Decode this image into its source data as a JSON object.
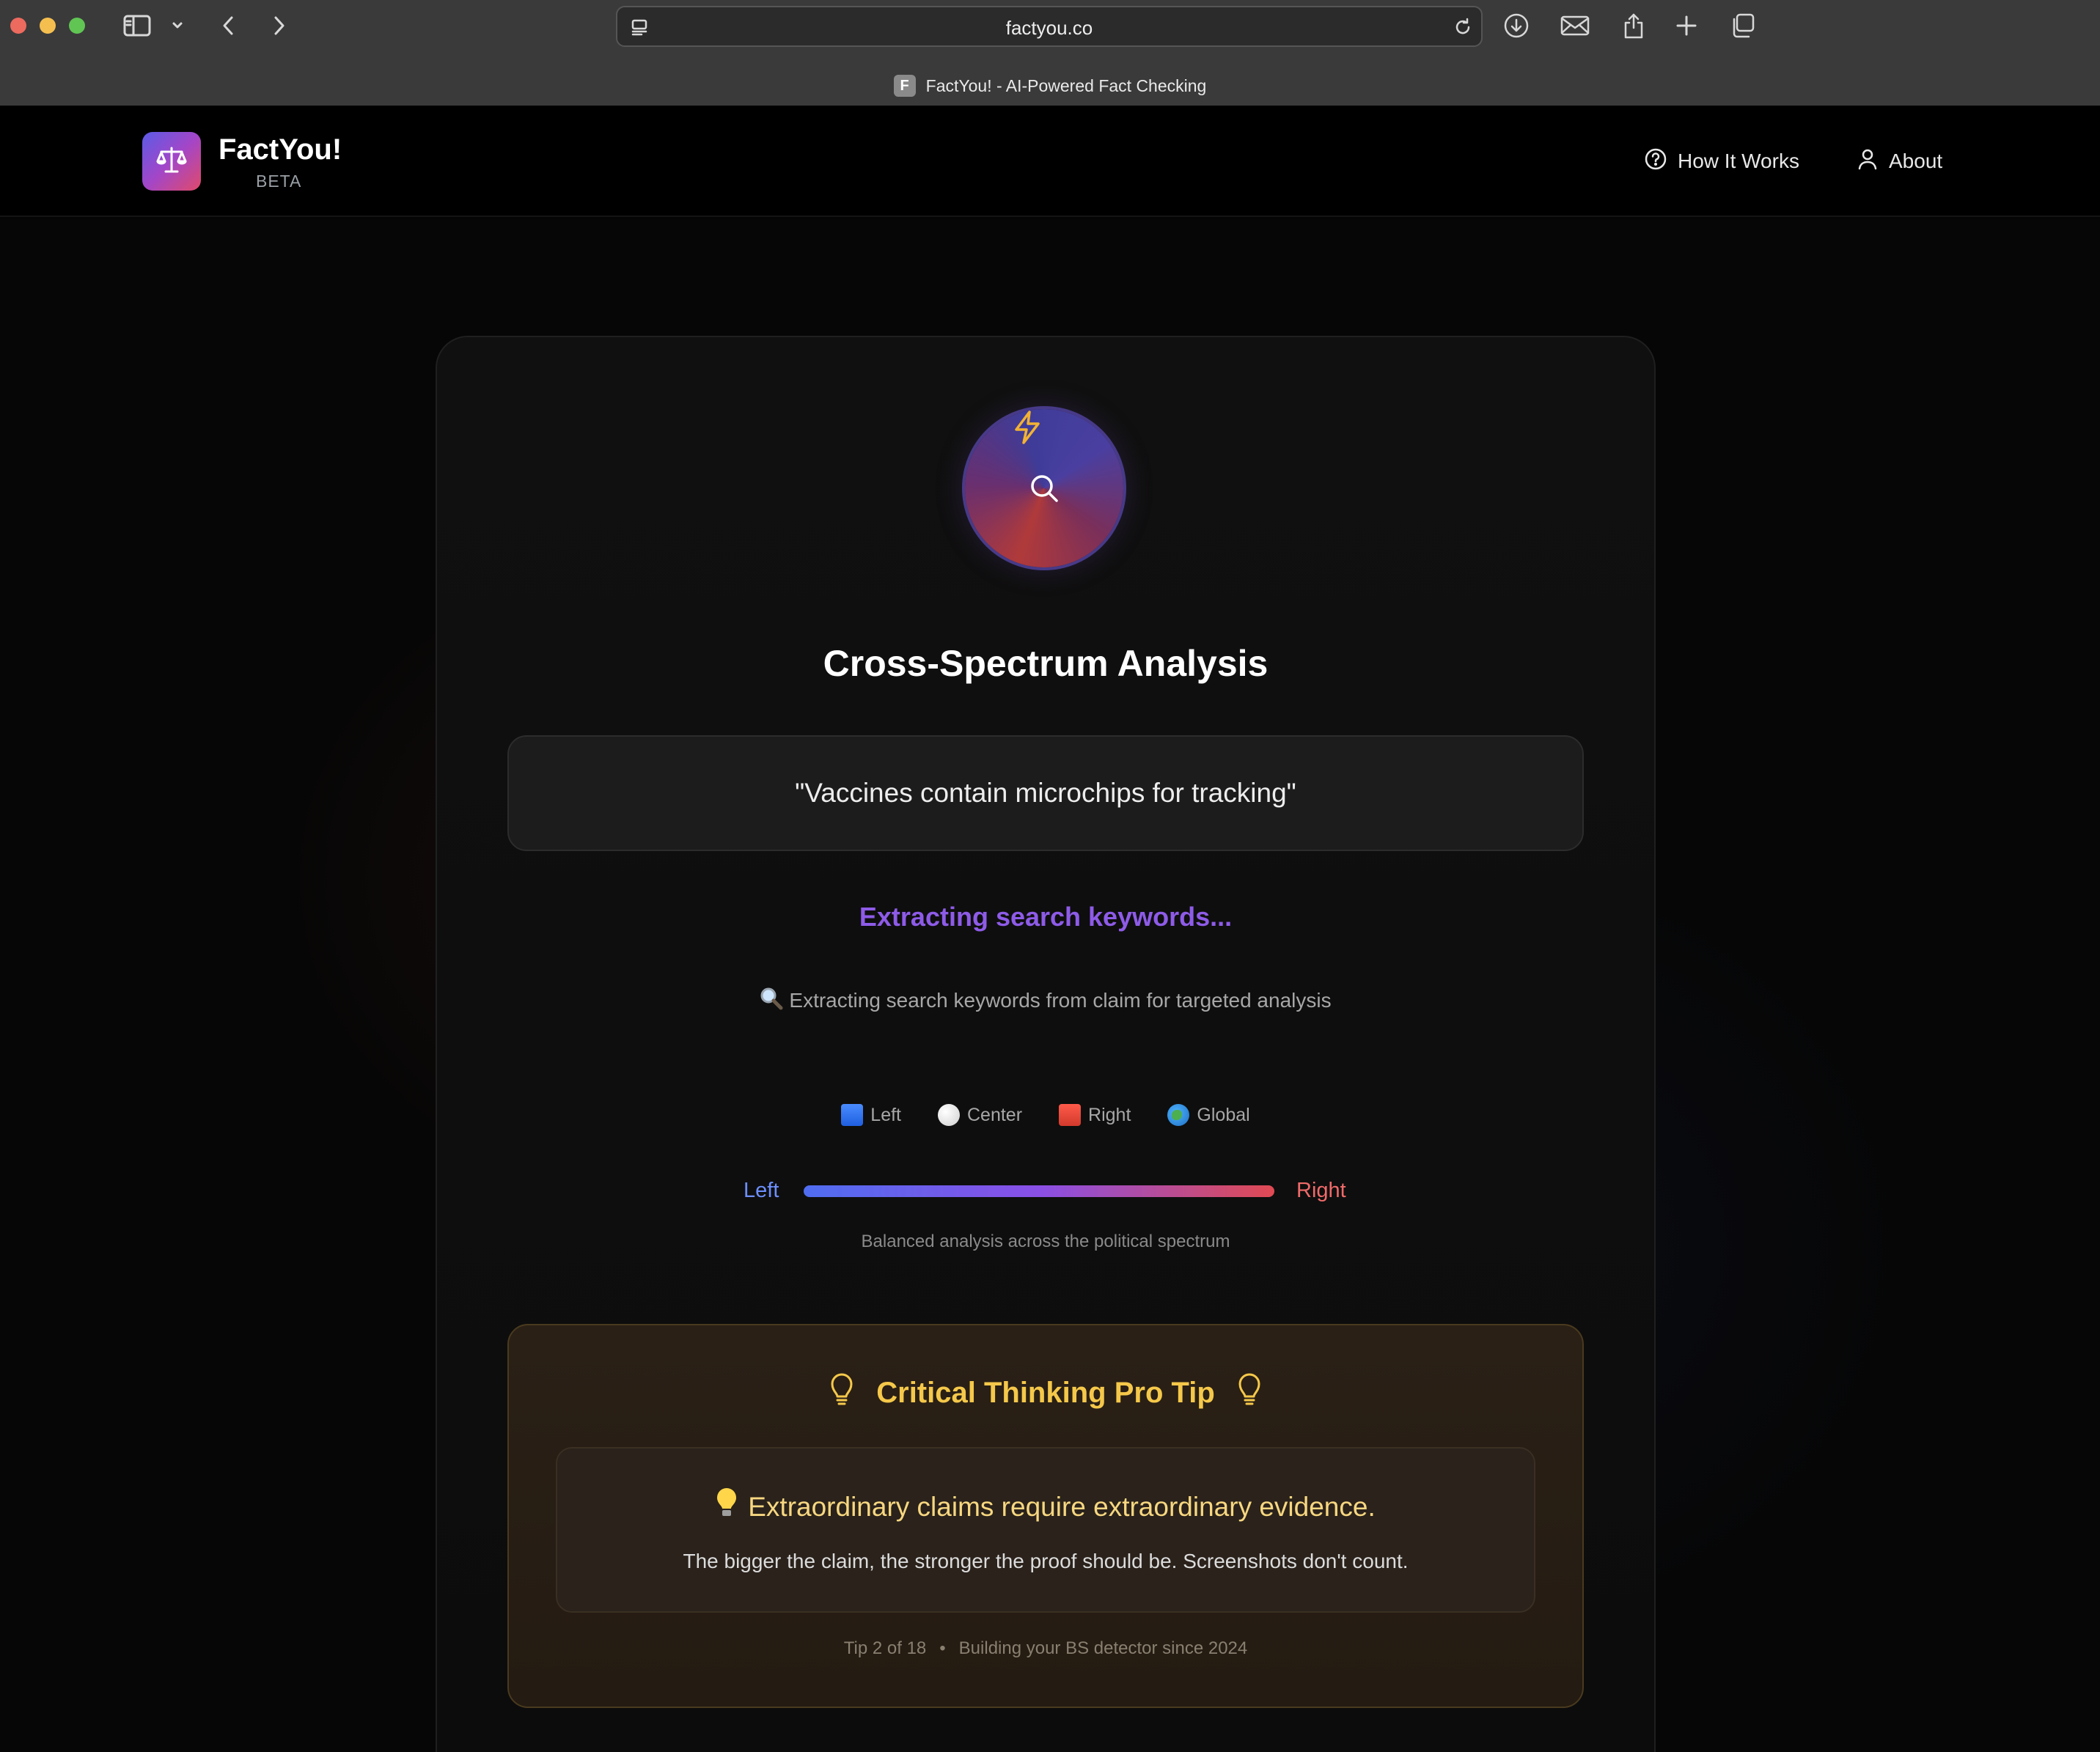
{
  "browser": {
    "url": "factyou.co",
    "tab_title": "FactYou! - AI-Powered Fact Checking",
    "favicon_letter": "F"
  },
  "header": {
    "brand_name": "FactYou!",
    "brand_badge": "BETA",
    "logo_icon": "scale-icon",
    "nav": [
      {
        "label": "How It Works",
        "icon": "help-circle-icon"
      },
      {
        "label": "About",
        "icon": "user-icon"
      }
    ]
  },
  "analysis": {
    "title": "Cross-Spectrum Analysis",
    "claim": "\"Vaccines contain microchips for tracking\"",
    "status": "Extracting search keywords...",
    "status_detail": "Extracting search keywords from claim for targeted analysis",
    "status_detail_icon": "magnifier-emoji",
    "orb_icons": [
      "bolt-icon",
      "search-icon"
    ],
    "legend": [
      {
        "label": "Left",
        "icon": "blue-square-emoji"
      },
      {
        "label": "Center",
        "icon": "white-circle-emoji"
      },
      {
        "label": "Right",
        "icon": "red-square-emoji"
      },
      {
        "label": "Global",
        "icon": "globe-emoji"
      }
    ],
    "spectrum": {
      "left_label": "Left",
      "right_label": "Right",
      "caption": "Balanced analysis across the political spectrum",
      "colors": {
        "left": "#4f6df0",
        "center": "#8a4fe6",
        "right": "#e04a52"
      }
    }
  },
  "tip": {
    "heading": "Critical Thinking Pro Tip",
    "heading_icon": "lightbulb-icon",
    "main_icon": "lightbulb-emoji",
    "main": "Extraordinary claims require extraordinary evidence.",
    "sub": "The bigger the claim, the stronger the proof should be. Screenshots don't count.",
    "counter": "Tip 2 of 18",
    "separator": "•",
    "tagline": "Building your BS detector since 2024"
  },
  "colors": {
    "accent_purple": "#8e5be8",
    "tip_gold": "#f5c84a",
    "spectrum_left": "#6d8fff",
    "spectrum_right": "#f06a6a"
  }
}
